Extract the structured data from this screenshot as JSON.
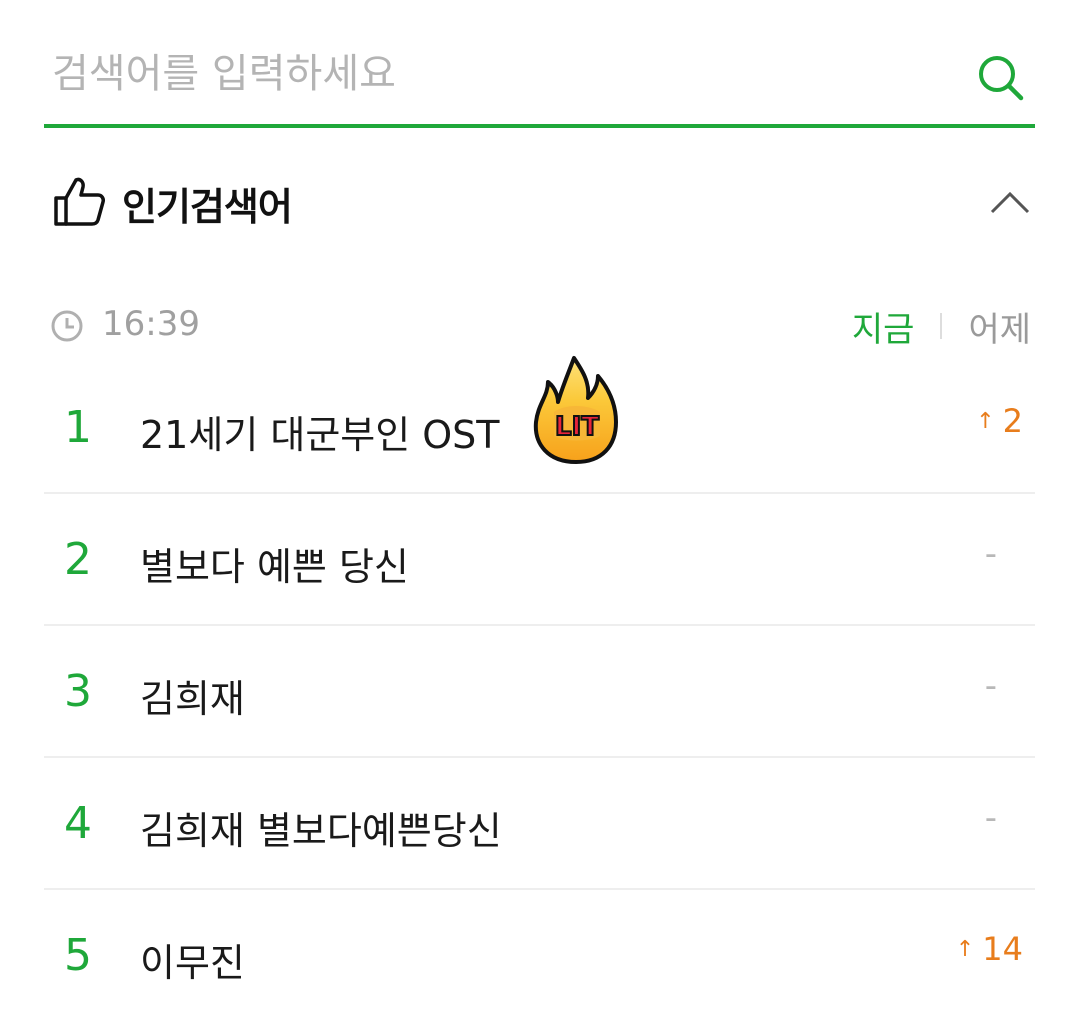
{
  "search": {
    "placeholder": "검색어를 입력하세요",
    "value": ""
  },
  "popular": {
    "title": "인기검색어",
    "time": "16:39",
    "tab_now": "지금",
    "tab_yesterday": "어제",
    "selected_tab": "지금"
  },
  "sticker": {
    "text": "LIT"
  },
  "rankings": [
    {
      "rank": "1",
      "keyword": "21세기 대군부인 OST",
      "change": "2",
      "direction": "up"
    },
    {
      "rank": "2",
      "keyword": "별보다 예쁜 당신",
      "change": "-",
      "direction": "same"
    },
    {
      "rank": "3",
      "keyword": "김희재",
      "change": "-",
      "direction": "same"
    },
    {
      "rank": "4",
      "keyword": "김희재 별보다예쁜당신",
      "change": "-",
      "direction": "same"
    },
    {
      "rank": "5",
      "keyword": "이무진",
      "change": "14",
      "direction": "up"
    }
  ],
  "colors": {
    "accent": "#1fa83a",
    "up": "#e87d1c",
    "muted": "#a0a0a0"
  },
  "icons": {
    "search": "search-icon",
    "thumb": "thumbs-up-icon",
    "collapse": "chevron-up-icon",
    "clock": "clock-icon",
    "up_arrow": "arrow-up-icon"
  }
}
